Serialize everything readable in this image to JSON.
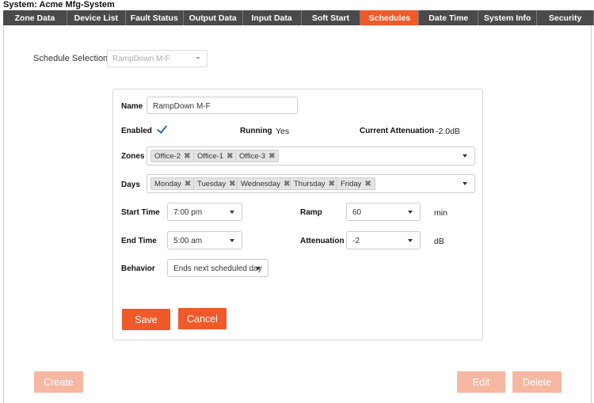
{
  "system_title": "System: Acme Mfg-System",
  "tabs": [
    {
      "label": "Zone Data",
      "width": 81
    },
    {
      "label": "Device List",
      "width": 74
    },
    {
      "label": "Fault Status",
      "width": 73
    },
    {
      "label": "Output Data",
      "width": 75
    },
    {
      "label": "Input Data",
      "width": 74
    },
    {
      "label": "Soft Start",
      "width": 75
    },
    {
      "label": "Schedules",
      "width": 74
    },
    {
      "label": "Date Time",
      "width": 75
    },
    {
      "label": "System Info",
      "width": 74
    },
    {
      "label": "Security",
      "width": 72
    }
  ],
  "active_tab": "Schedules",
  "schedule_selection": {
    "label": "Schedule Selection:",
    "value": "RampDown M-F"
  },
  "form": {
    "name_label": "Name",
    "name_value": "RampDown M-F",
    "enabled_label": "Enabled",
    "enabled": true,
    "running_label": "Running",
    "running_value": "Yes",
    "attenuation_current_label": "Current Attenuation",
    "attenuation_current_value": "-2.0dB",
    "zones_label": "Zones",
    "zones": [
      "Office-2",
      "Office-1",
      "Office-3"
    ],
    "days_label": "Days",
    "days": [
      "Monday",
      "Tuesday",
      "Wednesday",
      "Thursday",
      "Friday"
    ],
    "start_time_label": "Start Time",
    "start_time_value": "7:00 pm",
    "end_time_label": "End Time",
    "end_time_value": "5:00 am",
    "behavior_label": "Behavior",
    "behavior_value": "Ends next scheduled day",
    "ramp_label": "Ramp",
    "ramp_value": "60",
    "ramp_unit": "min",
    "attenuation_label": "Attenuation",
    "attenuation_value": "-2",
    "attenuation_unit": "dB",
    "chip_remove_glyph": "✖"
  },
  "buttons": {
    "save": "Save",
    "cancel": "Cancel",
    "create": "Create",
    "edit": "Edit",
    "delete": "Delete"
  },
  "colors": {
    "accent": "#f05a2a",
    "accent_disabled": "#f6b7a3",
    "tabbar": "#4a4a4a"
  }
}
